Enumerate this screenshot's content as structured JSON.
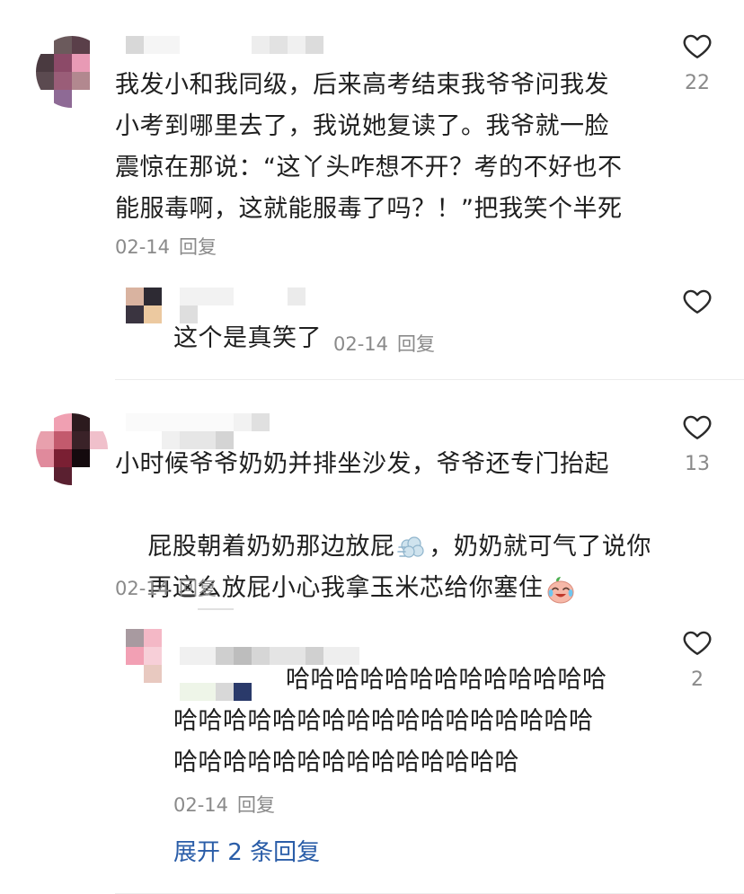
{
  "comments": [
    {
      "text": "我发小和我同级，后来高考结束我爷爷问我发\n小考到哪里去了，我说她复读了。我爷就一脸\n震惊在那说：“这丫头咋想不开？考的不好也不\n能服毒啊，这就能服毒了吗？！”把我笑个半死",
      "date": "02-14",
      "reply_label": "回复",
      "likes": "22",
      "reply": {
        "text": "这个是真笑了",
        "date": "02-14",
        "reply_label": "回复",
        "likes": ""
      }
    },
    {
      "text_lines": [
        "小时候爷爷奶奶并排坐沙发，爷爷还专门抬起",
        "屁股朝着奶奶那边放屁",
        "，奶奶就可气了说你",
        "再这么放屁小心我拿玉米芯给你塞住"
      ],
      "date": "02-14",
      "reply_label": "回复",
      "likes": "13",
      "reply": {
        "line1": "哈哈哈哈哈哈哈哈哈哈哈哈哈",
        "line2": "哈哈哈哈哈哈哈哈哈哈哈哈哈哈哈哈哈",
        "line3": "哈哈哈哈哈哈哈哈哈哈哈哈哈哈",
        "date": "02-14",
        "reply_label": "回复",
        "likes": "2"
      },
      "expand_label": "展开 2 条回复"
    }
  ],
  "icons": {
    "like": "heart-outline-icon",
    "wind": "dash-wind-icon",
    "laugh": "laughing-crying-emoji-icon"
  },
  "colors": {
    "text": "#1f1f1f",
    "meta": "#8a8a8a",
    "link": "#2a5da8",
    "divider": "#ececec"
  }
}
